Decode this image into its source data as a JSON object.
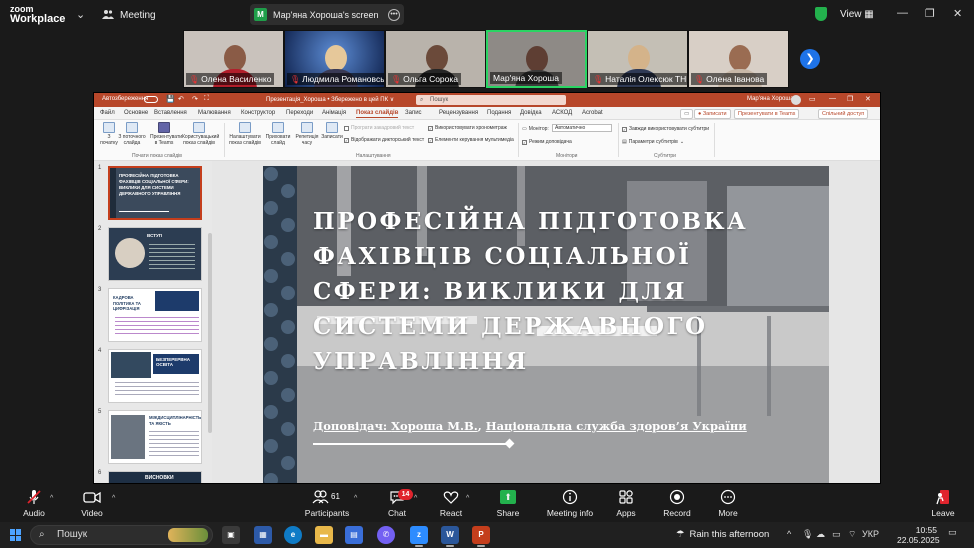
{
  "zoom": {
    "logo_line1": "zoom",
    "logo_line2": "Workplace",
    "meeting_label": "Meeting",
    "screen_share_label": "Мар'яна Хороша's screen",
    "view_label": "View"
  },
  "participants": [
    {
      "name": "Олена Василенко"
    },
    {
      "name": "Людмила Романовська"
    },
    {
      "name": "Ольга Сорока"
    },
    {
      "name": "Мар'яна Хороша"
    },
    {
      "name": "Наталія Олексюк ТНПУ"
    },
    {
      "name": "Олена Іванова"
    }
  ],
  "ppt": {
    "autosave": "Автозбереження",
    "filename": "Презентація_Хороша • Збережено в цей ПК ∨",
    "search_placeholder": "Пошук",
    "user": "Мар'яна Хороша",
    "tabs": [
      "Файл",
      "Основне",
      "Вставлення",
      "Малювання",
      "Конструктор",
      "Переходи",
      "Анімація",
      "Показ слайдів",
      "Запис",
      "Рецензування",
      "Подання",
      "Довідка",
      "АСКОД",
      "Acrobat"
    ],
    "active_tab": "Показ слайдів",
    "record_btn": "Записати",
    "present_teams_btn": "Презентувати в Teams",
    "share_btn": "Спільний доступ",
    "ribbon": {
      "btn_from_start": "З початку",
      "btn_from_current": "З поточного слайда",
      "btn_present_teams": "Презентувати в Teams",
      "btn_custom_show": "Користувацький показ слайдів",
      "group_start": "Почати показ слайдів",
      "btn_setup": "Налаштувати показ слайдів",
      "btn_hide": "Приховати слайд",
      "btn_rehearse": "Репетиція часу",
      "btn_record": "Записати",
      "chk_play_narrations": "Програти закадровий текст",
      "chk_use_timings": "Використовувати хронометраж",
      "chk_show_controls": "Відображати дикторський текст",
      "chk_show_media": "Елементи керування мультимедіа",
      "group_setup": "Налаштування",
      "monitor_label": "Монітор:",
      "monitor_value": "Автоматично",
      "chk_presenter_view": "Режим доповідача",
      "group_monitors": "Монітори",
      "chk_always_subtitles": "Завжди використовувати субтитри",
      "btn_subtitle_settings": "Параметри субтитрів",
      "group_subtitles": "Субтитри"
    },
    "thumbnails": [
      {
        "num": "1",
        "title": "ПРОФЕСІЙНА ПІДГОТОВКА ФАХІВЦІВ СОЦІАЛЬНОЇ СФЕРИ: ВИКЛИКИ ДЛЯ СИСТЕМИ ДЕРЖАВНОГО УПРАВЛІННЯ"
      },
      {
        "num": "2",
        "title": "ВСТУП"
      },
      {
        "num": "3",
        "title": "КАДРОВА ПОЛІТИКА ТА ЦИФРІЗАЦІЯ"
      },
      {
        "num": "4",
        "title": "БЕЗПЕРЕРВНА ОСВІТА"
      },
      {
        "num": "5",
        "title": "МІЖДИСЦИПЛІНАРНІСТЬ ТА ЯКІСТЬ"
      },
      {
        "num": "6",
        "title": "ВИСНОВКИ"
      }
    ],
    "slide": {
      "title": "ПРОФЕСІЙНА ПІДГОТОВКА ФАХІВЦІВ СОЦІАЛЬНОЇ СФЕРИ: ВИКЛИКИ ДЛЯ СИСТЕМИ ДЕРЖАВНОГО УПРАВЛІННЯ",
      "speaker_prefix": "Доповідач: ",
      "speaker_name": "Хороша М.В.",
      "speaker_sep": ", ",
      "speaker_org": "Національна служба здоров’я України"
    }
  },
  "toolbar": {
    "audio": "Audio",
    "video": "Video",
    "participants": "Participants",
    "participants_count": "61",
    "chat": "Chat",
    "chat_badge": "14",
    "react": "React",
    "share": "Share",
    "meeting_info": "Meeting info",
    "apps": "Apps",
    "record": "Record",
    "more": "More",
    "leave": "Leave"
  },
  "taskbar": {
    "search": "Пошук",
    "weather": "Rain this afternoon",
    "lang": "УКР",
    "time": "10:55",
    "date": "22.05.2025"
  },
  "colors": {
    "ppt_accent": "#b7472a",
    "zoom_green": "#23b14d",
    "zoom_blue": "#1e73e8",
    "chat_badge": "#e0242d"
  }
}
